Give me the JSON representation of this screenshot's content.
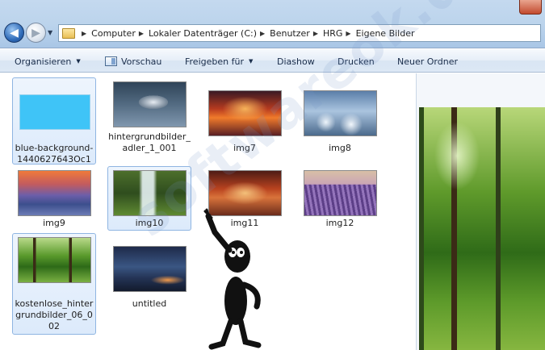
{
  "address_bar": {
    "crumbs": [
      "Computer",
      "Lokaler Datenträger (C:)",
      "Benutzer",
      "HRG",
      "Eigene Bilder"
    ]
  },
  "toolbar": {
    "organize": "Organisieren",
    "preview": "Vorschau",
    "share": "Freigeben für",
    "slideshow": "Diashow",
    "print": "Drucken",
    "new_folder": "Neuer Ordner"
  },
  "files": [
    {
      "name": "blue-background-1440627643Oc1",
      "selected": true
    },
    {
      "name": "hintergrundbilder_adler_1_001",
      "selected": false
    },
    {
      "name": "img7",
      "selected": false
    },
    {
      "name": "img8",
      "selected": false
    },
    {
      "name": "img9",
      "selected": false
    },
    {
      "name": "img10",
      "selected": true
    },
    {
      "name": "img11",
      "selected": false
    },
    {
      "name": "img12",
      "selected": false
    },
    {
      "name": "kostenlose_hintergrundbilder_06_002",
      "selected": true
    },
    {
      "name": "untitled",
      "selected": false
    }
  ],
  "watermark": "softwareok.de",
  "colors": {
    "selection_bg": "#dceafb",
    "selection_border": "#8fb5e2",
    "toolbar_text": "#1b2e4b"
  }
}
